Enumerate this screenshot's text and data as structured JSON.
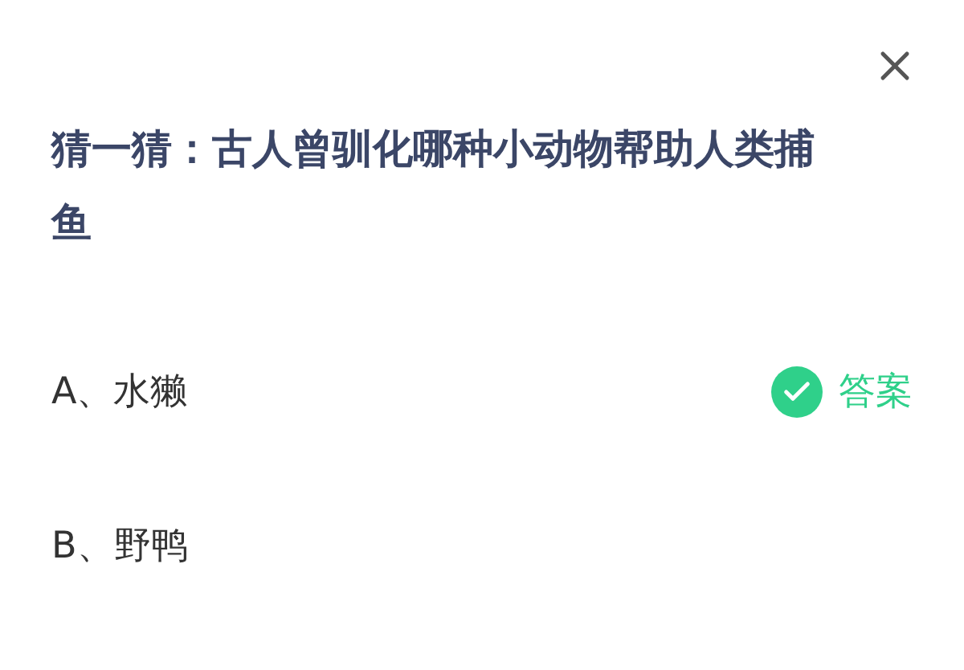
{
  "question": "猜一猜：古人曾驯化哪种小动物帮助人类捕鱼",
  "answer_label": "答案",
  "options": [
    {
      "label": "A、水獭",
      "correct": true
    },
    {
      "label": "B、野鸭",
      "correct": false
    }
  ]
}
